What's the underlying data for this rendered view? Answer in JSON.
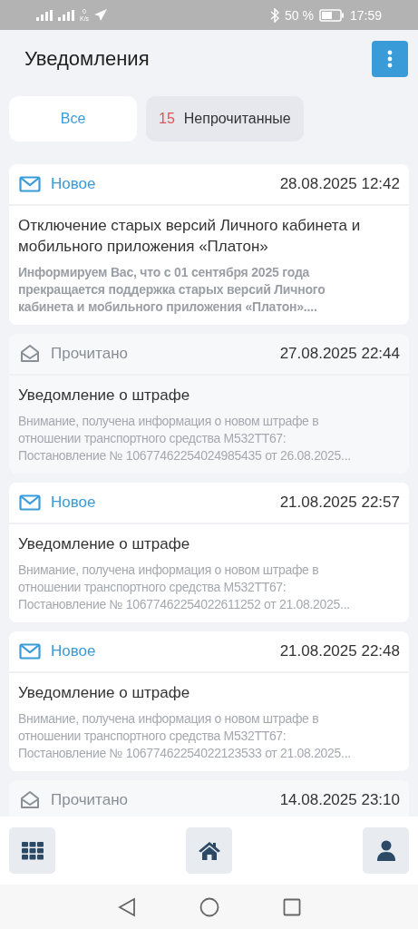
{
  "status_bar": {
    "speed_value": "0",
    "speed_unit": "K/s",
    "battery": "50 %",
    "time": "17:59"
  },
  "header": {
    "title": "Уведомления"
  },
  "tabs": [
    {
      "label": "Все",
      "selected": true
    },
    {
      "count": "15",
      "label": "Непрочитанные",
      "selected": false
    }
  ],
  "notifications": [
    {
      "status": "Новое",
      "read": false,
      "date": "28.08.2025 12:42",
      "title": "Отключение старых версий Личного кабинета и мобильного приложения «Платон»",
      "body": "Информируем Вас, что с 01 сентября 2025 года\nпрекращается поддержка старых версий Личного\nкабинета и мобильного приложения «Платон»....",
      "body_bold": true
    },
    {
      "status": "Прочитано",
      "read": true,
      "date": "27.08.2025 22:44",
      "title": "Уведомление о штрафе",
      "body": "Внимание, получена информация о новом штрафе в\nотношении транспортного средства М532ТТ67:\nПостановление № 10677462254024985435 от 26.08.2025...",
      "body_bold": false
    },
    {
      "status": "Новое",
      "read": false,
      "date": "21.08.2025 22:57",
      "title": "Уведомление о штрафе",
      "body": "Внимание, получена информация о новом штрафе в\nотношении транспортного средства М532ТТ67:\nПостановление № 10677462254022611252 от 21.08.2025...",
      "body_bold": false
    },
    {
      "status": "Новое",
      "read": false,
      "date": "21.08.2025 22:48",
      "title": "Уведомление о штрафе",
      "body": "Внимание, получена информация о новом штрафе в\nотношении транспортного средства М532ТТ67:\nПостановление № 10677462254022123533 от 21.08.2025...",
      "body_bold": false
    },
    {
      "status": "Прочитано",
      "read": true,
      "date": "14.08.2025 23:10"
    }
  ]
}
